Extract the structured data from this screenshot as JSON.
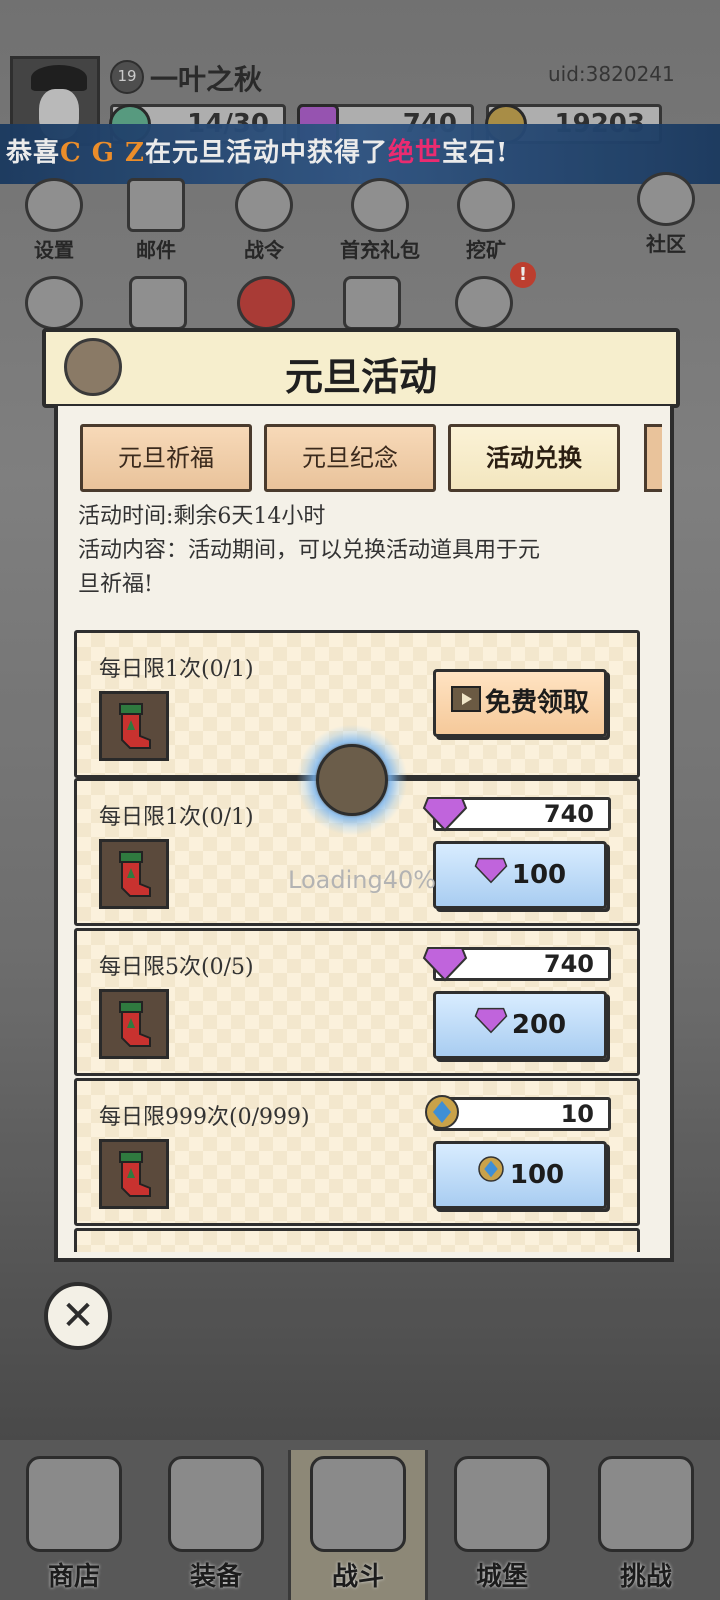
{
  "header": {
    "level": "19",
    "player_name": "一叶之秋",
    "uid": "uid:3820241",
    "resources": [
      {
        "icon": "stamina-icon",
        "value": "14/30"
      },
      {
        "icon": "gem-icon",
        "value": "740"
      },
      {
        "icon": "gold-coin-icon",
        "value": "19203"
      }
    ]
  },
  "banner": {
    "prefix": "恭喜",
    "player": "C G Z",
    "middle": "在元旦活动中获得了",
    "rarity": "绝世",
    "suffix": "宝石!"
  },
  "top_icons": [
    {
      "name": "settings",
      "label": "设置"
    },
    {
      "name": "mail",
      "label": "邮件"
    },
    {
      "name": "battle-pass",
      "label": "战令"
    },
    {
      "name": "first-recharge",
      "label": "首充礼包"
    },
    {
      "name": "mining",
      "label": "挖矿"
    },
    {
      "name": "community",
      "label": "社区"
    }
  ],
  "dialog": {
    "title": "元旦活动",
    "tabs": [
      "元旦祈福",
      "元旦纪念",
      "活动兑换"
    ],
    "active_tab": "活动兑换",
    "time_text": "活动时间:剩余6天14小时",
    "content_line1": "活动内容：活动期间，可以兑换活动道具用于元",
    "content_line2": "旦祈福!",
    "cards": [
      {
        "limit": "每日限1次(0/1)",
        "button": "免费领取"
      },
      {
        "limit": "每日限1次(0/1)",
        "have": "740",
        "cost": "100"
      },
      {
        "limit": "每日限5次(0/5)",
        "have": "740",
        "cost": "200"
      },
      {
        "limit": "每日限999次(0/999)",
        "have": "10",
        "cost": "100"
      }
    ]
  },
  "loading": "Loading40%",
  "bottom_nav": [
    {
      "label": "商店"
    },
    {
      "label": "装备"
    },
    {
      "label": "战斗"
    },
    {
      "label": "城堡"
    },
    {
      "label": "挑战"
    }
  ],
  "colors": {
    "banner_bg": "#2a4d7c",
    "highlight_orange": "#ff9a2e",
    "highlight_pink": "#ff2f7a",
    "button_blue": "#a9cdf1",
    "button_free": "#f5c99a",
    "gem_purple": "#b84fd6"
  }
}
